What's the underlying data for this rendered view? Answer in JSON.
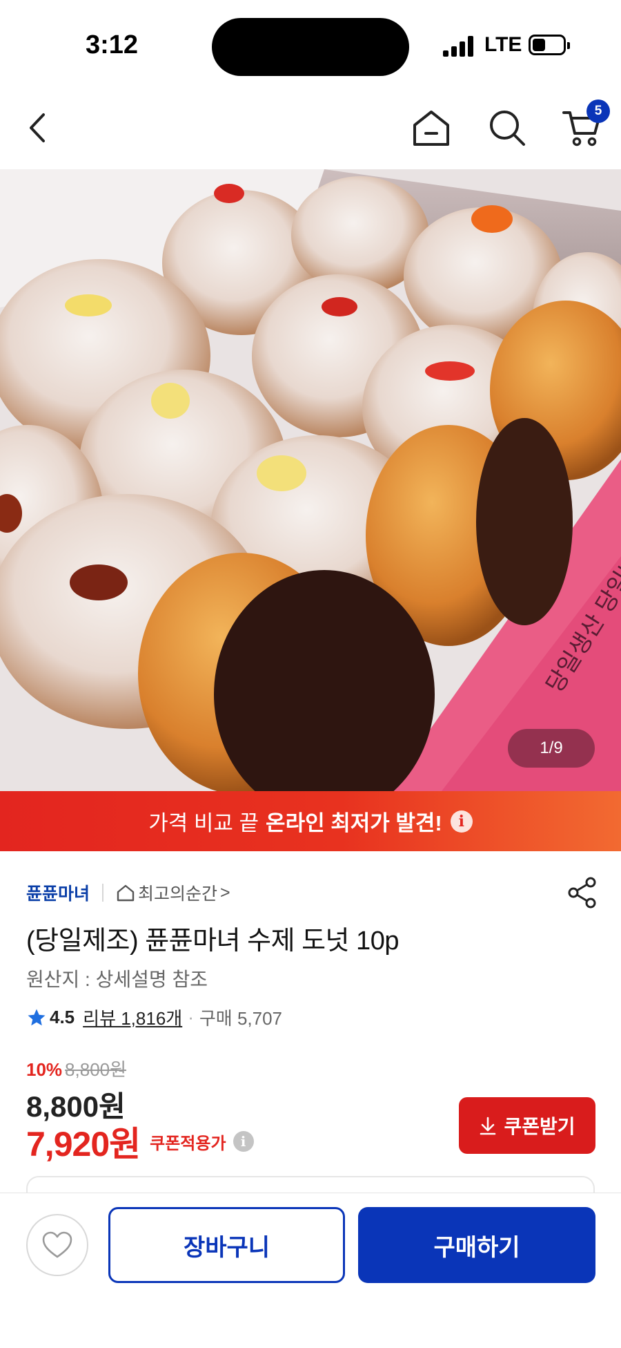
{
  "status_bar": {
    "time": "3:12",
    "network": "LTE"
  },
  "nav": {
    "back_icon": "chevron-left-icon",
    "home_icon": "home-icon",
    "search_icon": "search-icon",
    "cart_icon": "cart-icon",
    "cart_count": "5"
  },
  "hero": {
    "page_indicator": "1/9",
    "box_text": "당일생산 당일배송"
  },
  "promo": {
    "text": "가격 비교 끝",
    "bold_text": "온라인 최저가 발견!",
    "info": "i"
  },
  "product": {
    "seller": "퓬퓬마녀",
    "brand_link": "최고의순간",
    "brand_link_arrow": ">",
    "title": "(당일제조) 퓬퓬마녀 수제 도넛 10p",
    "origin": "원산지 : 상세설명 참조",
    "rating": "4.5",
    "review_label": "리뷰 1,816개",
    "separator": "·",
    "purchase_label": "구매 5,707",
    "discount_rate": "10%",
    "original_price": "8,800원",
    "sale_price": "8,800원",
    "coupon_price": "7,920원",
    "coupon_label": "쿠폰적용가",
    "info": "i",
    "coupon_button": "쿠폰받기"
  },
  "bottom": {
    "cart_button": "장바구니",
    "buy_button": "구매하기"
  },
  "colors": {
    "brand_blue": "#0a35b8",
    "sale_red": "#e3251f",
    "coupon_red": "#d91c1c",
    "star": "#1f6fe0"
  }
}
